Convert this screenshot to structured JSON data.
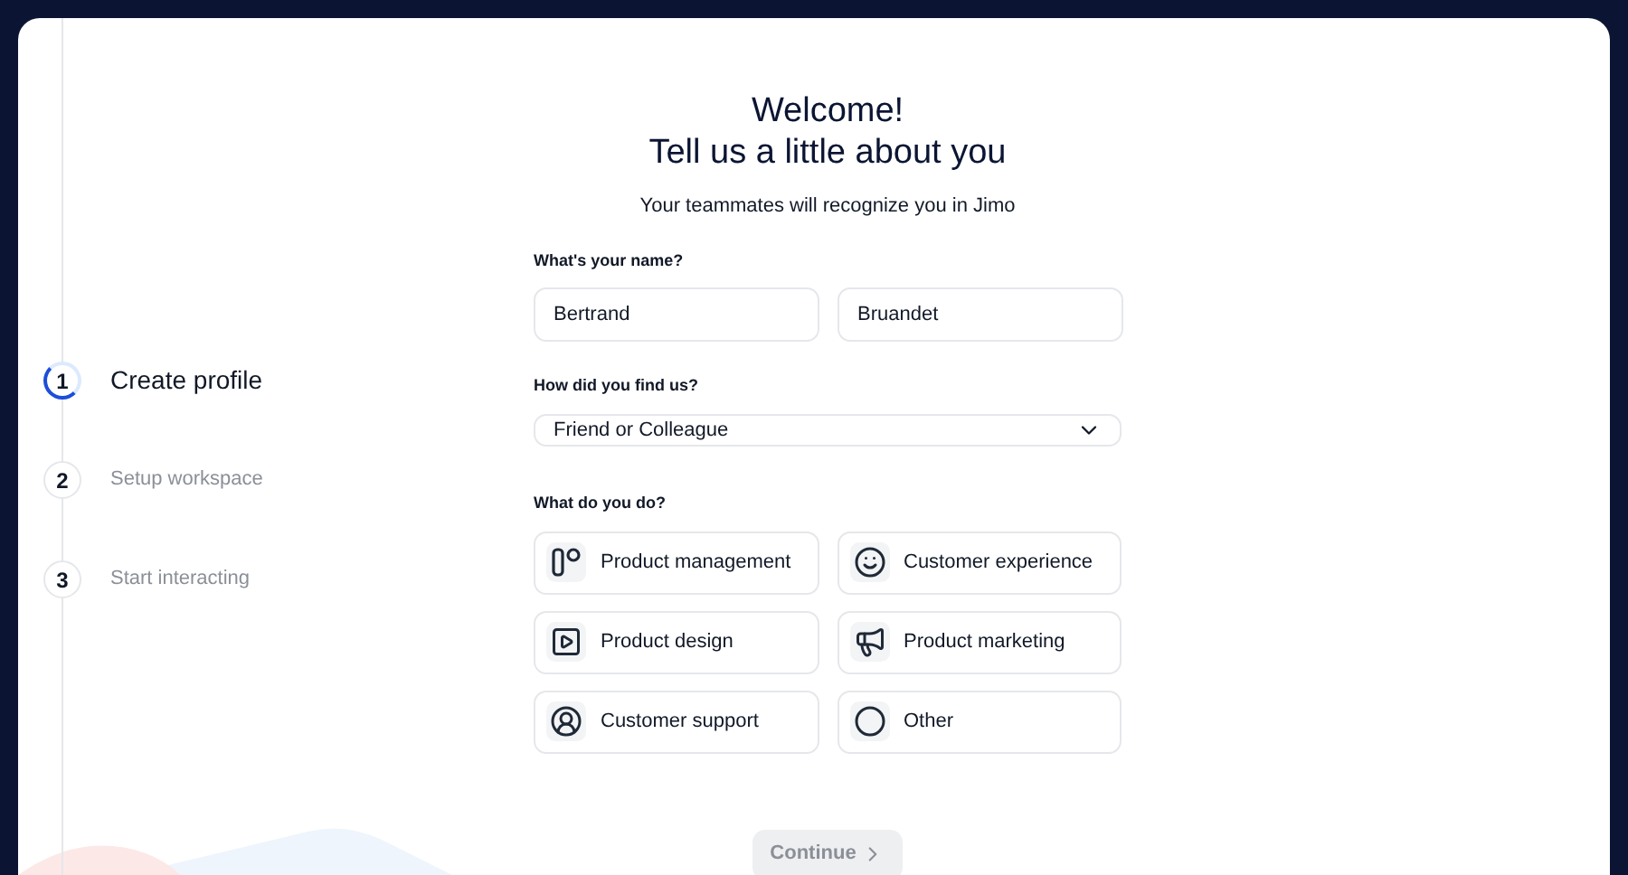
{
  "steps": [
    {
      "number": "1",
      "label": "Create profile",
      "selected": true
    },
    {
      "number": "2",
      "label": "Setup workspace",
      "selected": false
    },
    {
      "number": "3",
      "label": "Start interacting",
      "selected": false
    }
  ],
  "heading": [
    "Welcome!",
    "Tell us a little about you"
  ],
  "subtitle": "Your teammates will recognize you in Jimo",
  "name_label": "What's your name?",
  "first_name": {
    "value": "Bertrand"
  },
  "last_name": {
    "value": "Bruandet"
  },
  "source_label": "How did you find us?",
  "source_select": {
    "value": "Friend or Colleague"
  },
  "role_label": "What do you do?",
  "roles": [
    {
      "kind": "management",
      "label": "Product management"
    },
    {
      "kind": "experience",
      "label": "Customer experience"
    },
    {
      "kind": "design",
      "label": "Product design"
    },
    {
      "kind": "marketing",
      "label": "Product marketing"
    },
    {
      "kind": "support",
      "label": "Customer support"
    },
    {
      "kind": "other",
      "label": "Other"
    }
  ],
  "continue_button": {
    "label": "Continue",
    "disabled": true
  }
}
